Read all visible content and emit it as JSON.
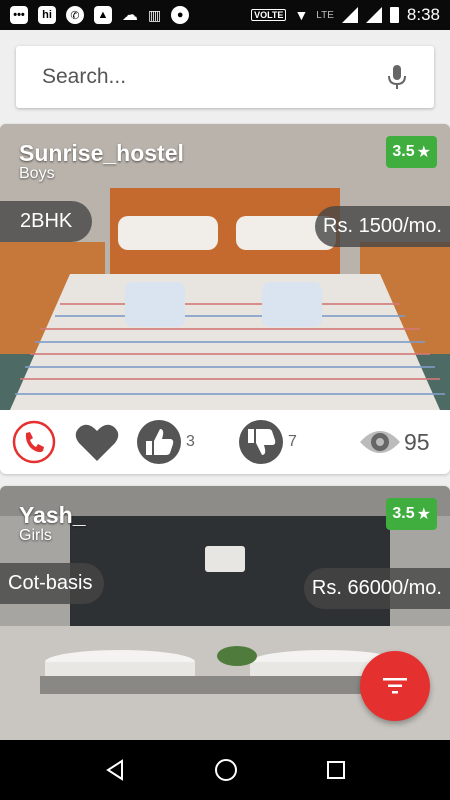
{
  "status_bar": {
    "volte": "VOLTE",
    "network": "LTE",
    "time": "8:38"
  },
  "search": {
    "placeholder": "Search..."
  },
  "listings": [
    {
      "name": "Sunrise_hostel",
      "gender": "Boys",
      "rating": "3.5",
      "room_type": "2BHK",
      "price": "Rs. 1500/mo.",
      "likes": "3",
      "dislikes": "7",
      "views": "95"
    },
    {
      "name": "Yash_",
      "gender": "Girls",
      "rating": "3.5",
      "room_type": "Cot-basis",
      "price": "Rs. 66000/mo."
    }
  ],
  "colors": {
    "accent": "#e53030",
    "rating_bg": "#3fae3f"
  }
}
